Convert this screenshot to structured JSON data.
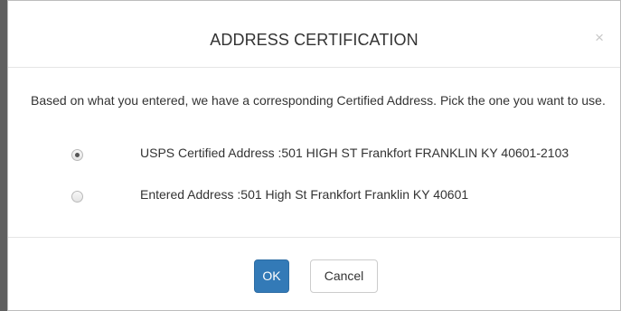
{
  "dialog": {
    "title": "ADDRESS CERTIFICATION",
    "close_glyph": "×",
    "prompt": "Based on what you entered, we have a corresponding Certified Address. Pick the one you want to use.",
    "options": [
      {
        "label": "USPS Certified Address :501 HIGH ST Frankfort FRANKLIN KY 40601-2103",
        "selected": true
      },
      {
        "label": "Entered Address :501 High St Frankfort Franklin KY 40601",
        "selected": false
      }
    ],
    "ok_label": "OK",
    "cancel_label": "Cancel"
  },
  "colors": {
    "primary": "#337ab7",
    "backdrop": "#5f5f5f"
  }
}
